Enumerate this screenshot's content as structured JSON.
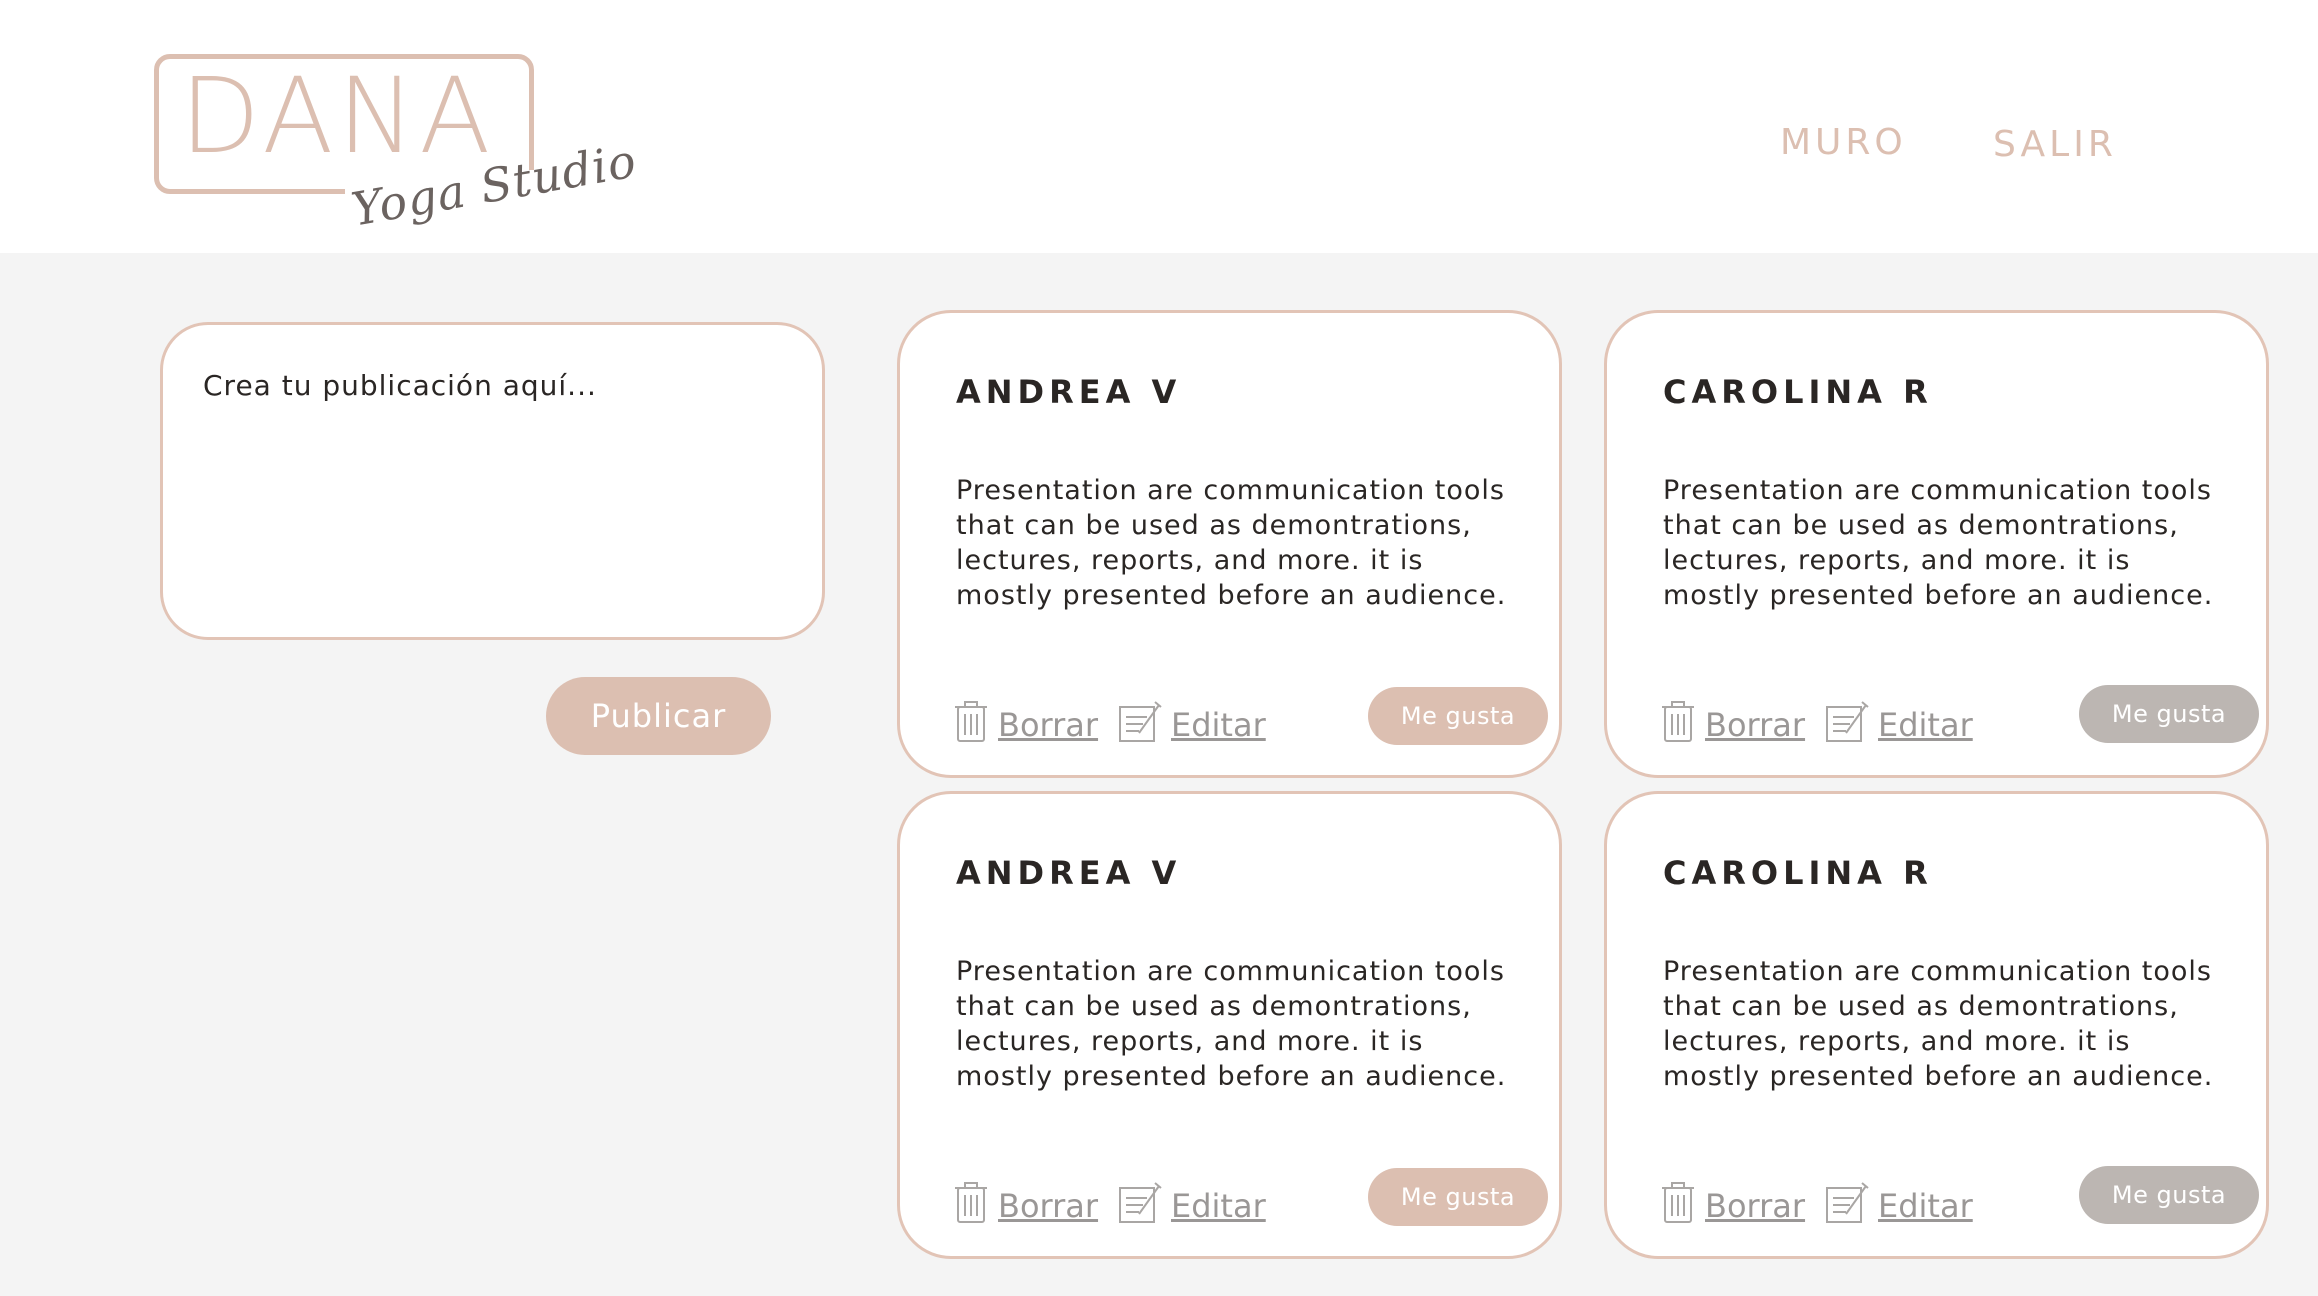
{
  "header": {
    "logo_text": "DANA",
    "logo_subtext": "Yoga Studio",
    "nav": [
      {
        "label": "MURO"
      },
      {
        "label": "SALIR"
      }
    ]
  },
  "composer": {
    "placeholder": "Crea tu publicación aquí...",
    "value": ""
  },
  "publish_label": "Publicar",
  "colors": {
    "accent": "#dcbfb1",
    "like_active": "#dcbfb1",
    "like_inactive": "#bcb6b2",
    "background": "#f4f4f4"
  },
  "posts": [
    {
      "author": "ANDREA V",
      "body": "Presentation are communication tools that can be used as demontrations, lectures, reports, and more. it is mostly presented before an audience.",
      "delete_label": "Borrar",
      "edit_label": "Editar",
      "like_label": "Me gusta",
      "like_state": "active",
      "delete_icon": "trash-icon",
      "edit_icon": "edit-icon"
    },
    {
      "author": "CAROLINA R",
      "body": "Presentation are communication tools that can be used as demontrations, lectures, reports, and more. it is mostly presented before an audience.",
      "delete_label": "Borrar",
      "edit_label": "Editar",
      "like_label": "Me gusta",
      "like_state": "inactive",
      "delete_icon": "trash-icon",
      "edit_icon": "edit-icon"
    },
    {
      "author": "ANDREA V",
      "body": "Presentation are communication tools that can be used as demontrations, lectures, reports, and more. it is mostly presented before an audience.",
      "delete_label": "Borrar",
      "edit_label": "Editar",
      "like_label": "Me gusta",
      "like_state": "active",
      "delete_icon": "trash-icon",
      "edit_icon": "edit-icon"
    },
    {
      "author": "CAROLINA R",
      "body": "Presentation are communication tools that can be used as demontrations, lectures, reports, and more. it is mostly presented before an audience.",
      "delete_label": "Borrar",
      "edit_label": "Editar",
      "like_label": "Me gusta",
      "like_state": "inactive",
      "delete_icon": "trash-icon",
      "edit_icon": "edit-icon"
    }
  ]
}
